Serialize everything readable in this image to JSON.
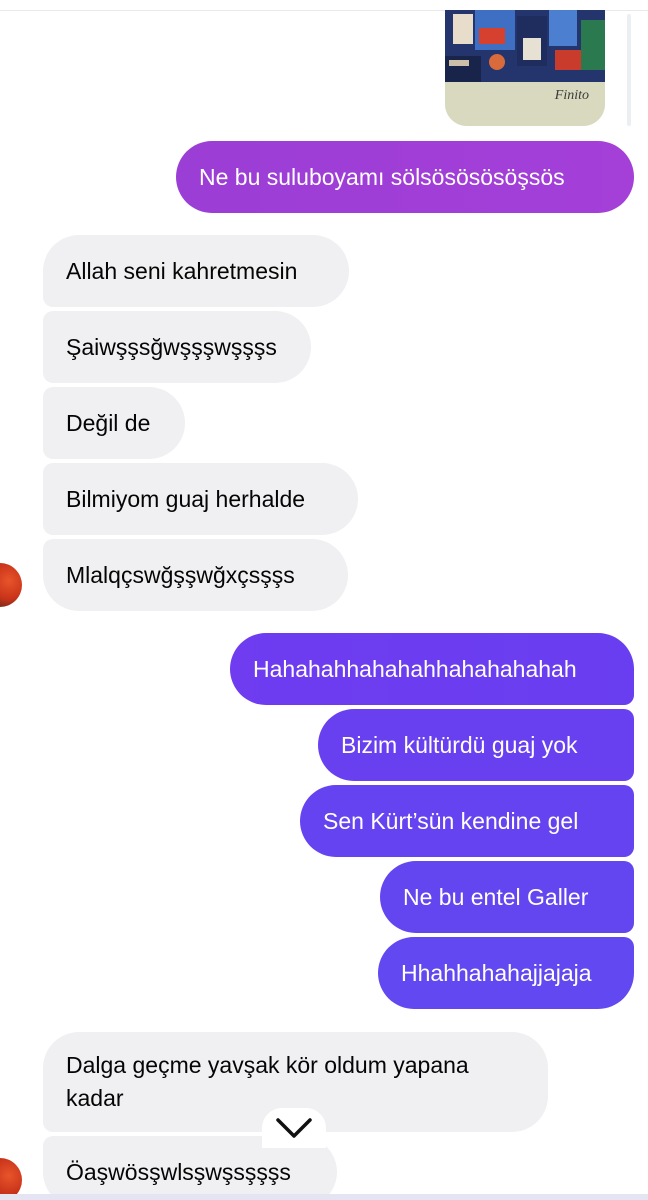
{
  "attachment": {
    "caption": "Finito"
  },
  "messages": [
    {
      "side": "sent",
      "text": "Ne bu suluboyamı sölsösösösöşsös",
      "color": "#9b3ed6"
    },
    {
      "side": "received",
      "text": "Allah seni kahretmesin"
    },
    {
      "side": "received",
      "text": "Şaiwşşsğwşşşwşşşs"
    },
    {
      "side": "received",
      "text": "Değil de"
    },
    {
      "side": "received",
      "text": "Bilmiyom guaj herhalde"
    },
    {
      "side": "received",
      "text": "Mlalqçswğşşwğxçsşşs"
    },
    {
      "side": "sent",
      "text": "Hahahahhahahahhahahahahah",
      "color": "#6a3ef0"
    },
    {
      "side": "sent",
      "text": "Bizim kültürdü guaj yok",
      "color": "#6940f0"
    },
    {
      "side": "sent",
      "text": "Sen Kürt’sün kendine gel",
      "color": "#6743f0"
    },
    {
      "side": "sent",
      "text": "Ne bu entel Galler",
      "color": "#6546f0"
    },
    {
      "side": "sent",
      "text": "Hhahhahahajjajaja",
      "color": "#6348f0"
    },
    {
      "side": "received",
      "text": "Dalga geçme yavşak kör oldum yapana kadar"
    },
    {
      "side": "received",
      "text": "Öaşwösşwlsşwşsşşşs"
    }
  ],
  "theme": {
    "received_bg": "#f0f0f2",
    "text_dark": "#050505",
    "text_light": "#ffffff"
  }
}
